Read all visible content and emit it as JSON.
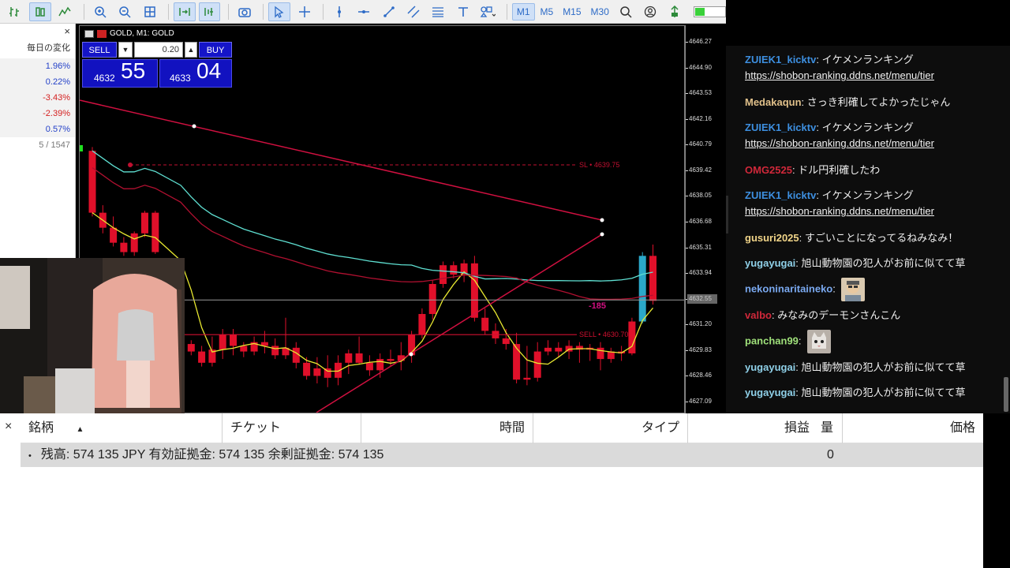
{
  "toolbar": {
    "timeframes": [
      "M1",
      "M5",
      "M15",
      "M30"
    ],
    "active_timeframe": "M1"
  },
  "market_watch": {
    "column_header": "毎日の変化",
    "rows": [
      {
        "value": "1.96%",
        "dir": "pos"
      },
      {
        "value": "0.22%",
        "dir": "pos"
      },
      {
        "value": "-3.43%",
        "dir": "neg"
      },
      {
        "value": "-2.39%",
        "dir": "neg"
      },
      {
        "value": "0.57%",
        "dir": "pos"
      }
    ],
    "count": "5 / 1547",
    "close": "×"
  },
  "chart": {
    "title": "GOLD, M1: GOLD",
    "sell_label": "SELL",
    "buy_label": "BUY",
    "lot": "0.20",
    "sell_price_small": "4632",
    "sell_price_big": "55",
    "buy_price_small": "4633",
    "buy_price_big": "04",
    "sl_label": "SL • 4639.75",
    "sell_order_label": "SELL • 4630.70",
    "pnl_label": "-185",
    "current_price": "4632.55",
    "colors": {
      "bear": "#e0102a",
      "bull": "#2ba8c9",
      "ma_yellow": "#e8e830",
      "ma_cyan": "#5fe0d2",
      "ma_red": "#b01030",
      "trend": "#d01040"
    }
  },
  "chart_data": {
    "type": "candlestick",
    "title": "GOLD, M1: GOLD",
    "y_ticks": [
      "4646.27",
      "4644.90",
      "4643.53",
      "4642.16",
      "4640.79",
      "4639.42",
      "4638.05",
      "4636.68",
      "4635.31",
      "4633.94",
      "4632.57",
      "4631.20",
      "4629.83",
      "4628.46",
      "4627.09"
    ],
    "ylim": [
      4627.09,
      4646.27
    ],
    "ohlc": [
      [
        4640.5,
        4640.7,
        4637.0,
        4637.2
      ],
      [
        4637.2,
        4637.6,
        4636.1,
        4636.4
      ],
      [
        4636.4,
        4637.0,
        4635.4,
        4635.6
      ],
      [
        4635.6,
        4635.9,
        4634.9,
        4635.1
      ],
      [
        4635.1,
        4636.2,
        4634.9,
        4636.1
      ],
      [
        4636.1,
        4637.3,
        4635.9,
        4637.2
      ],
      [
        4637.2,
        4637.3,
        4635.0,
        4635.1
      ],
      [
        4630.9,
        4631.3,
        4630.0,
        4630.2
      ],
      [
        4630.2,
        4630.4,
        4629.6,
        4629.8
      ],
      [
        4629.8,
        4630.1,
        4629.0,
        4629.2
      ],
      [
        4629.2,
        4630.6,
        4629.0,
        4629.9
      ],
      [
        4629.9,
        4631.0,
        4629.4,
        4630.7
      ],
      [
        4630.7,
        4631.0,
        4629.6,
        4630.1
      ],
      [
        4630.1,
        4630.3,
        4629.5,
        4629.8
      ],
      [
        4629.8,
        4630.6,
        4629.6,
        4630.3
      ],
      [
        4630.3,
        4630.9,
        4629.7,
        4630.1
      ],
      [
        4630.1,
        4630.5,
        4629.4,
        4629.6
      ],
      [
        4629.6,
        4631.6,
        4629.4,
        4630.0
      ],
      [
        4630.0,
        4630.3,
        4628.9,
        4629.2
      ],
      [
        4629.2,
        4629.5,
        4628.3,
        4628.5
      ],
      [
        4628.5,
        4629.5,
        4628.1,
        4628.9
      ],
      [
        4628.9,
        4629.6,
        4627.9,
        4628.4
      ],
      [
        4628.4,
        4629.6,
        4628.0,
        4629.2
      ],
      [
        4629.2,
        4629.9,
        4628.6,
        4629.7
      ],
      [
        4629.7,
        4630.6,
        4629.1,
        4629.2
      ],
      [
        4629.2,
        4629.6,
        4628.5,
        4628.8
      ],
      [
        4628.8,
        4629.7,
        4628.4,
        4629.4
      ],
      [
        4629.4,
        4629.9,
        4629.0,
        4629.3
      ],
      [
        4629.3,
        4630.3,
        4628.8,
        4629.6
      ],
      [
        4629.6,
        4630.9,
        4629.2,
        4630.7
      ],
      [
        4630.7,
        4632.1,
        4630.5,
        4631.8
      ],
      [
        4631.8,
        4633.6,
        4631.5,
        4633.4
      ],
      [
        4633.4,
        4634.6,
        4633.2,
        4634.4
      ],
      [
        4634.4,
        4634.6,
        4633.7,
        4633.9
      ],
      [
        4633.9,
        4634.7,
        4633.5,
        4634.5
      ],
      [
        4634.5,
        4634.9,
        4631.4,
        4631.6
      ],
      [
        4631.6,
        4632.1,
        4630.7,
        4630.9
      ],
      [
        4630.9,
        4631.3,
        4630.2,
        4630.5
      ],
      [
        4630.5,
        4631.0,
        4629.9,
        4630.2
      ],
      [
        4630.2,
        4630.8,
        4628.1,
        4628.3
      ],
      [
        4628.3,
        4630.1,
        4628.0,
        4628.4
      ],
      [
        4628.4,
        4630.3,
        4628.2,
        4629.8
      ],
      [
        4629.8,
        4630.4,
        4629.6,
        4630.0
      ],
      [
        4630.0,
        4630.3,
        4629.5,
        4629.8
      ],
      [
        4629.8,
        4630.4,
        4629.4,
        4630.1
      ],
      [
        4630.1,
        4630.3,
        4629.2,
        4629.9
      ],
      [
        4629.9,
        4630.2,
        4629.3,
        4630.0
      ],
      [
        4630.0,
        4630.3,
        4628.8,
        4629.4
      ],
      [
        4629.4,
        4630.0,
        4629.2,
        4629.8
      ],
      [
        4629.8,
        4630.1,
        4629.3,
        4629.7
      ],
      [
        4629.7,
        4631.6,
        4629.6,
        4631.4
      ],
      [
        4631.4,
        4635.1,
        4631.3,
        4634.9
      ],
      [
        4634.9,
        4635.5,
        4632.3,
        4632.5
      ]
    ]
  },
  "chat": {
    "messages": [
      {
        "user": "ZUIEK1_kicktv",
        "color": "#3d8fe0",
        "text": "イケメンランキング",
        "link": "https://shobon-ranking.ddns.net/menu/tier"
      },
      {
        "user": "Medakaqun",
        "color": "#e0c08a",
        "text": "さっき利確してよかったじゃん"
      },
      {
        "user": "ZUIEK1_kicktv",
        "color": "#3d8fe0",
        "text": "イケメンランキング",
        "link": "https://shobon-ranking.ddns.net/menu/tier"
      },
      {
        "user": "OMG2525",
        "color": "#d0283a",
        "text": "ドル円利確したわ"
      },
      {
        "user": "ZUIEK1_kicktv",
        "color": "#3d8fe0",
        "text": "イケメンランキング",
        "link": "https://shobon-ranking.ddns.net/menu/tier"
      },
      {
        "user": "gusuri2025",
        "color": "#f0d488",
        "text": "すごいことになってるねみなみ！"
      },
      {
        "user": "yugayugai",
        "color": "#8fd0e8",
        "text": "旭山動物園の犯人がお前に似てて草"
      },
      {
        "user": "nekoninaritaineko",
        "color": "#7aa9f0",
        "text": ""
      },
      {
        "user": "valbo",
        "color": "#d0283a",
        "text": "みなみのデーモンさんこん"
      },
      {
        "user": "panchan99",
        "color": "#9fe07a",
        "text": ""
      },
      {
        "user": "yugayugai",
        "color": "#8fd0e8",
        "text": "旭山動物園の犯人がお前に似てて草"
      },
      {
        "user": "yugayugai",
        "color": "#8fd0e8",
        "text": "旭山動物園の犯人がお前に似てて草"
      }
    ]
  },
  "terminal": {
    "close": "×",
    "columns": [
      "銘柄",
      "チケット",
      "時間",
      "タイプ",
      "損益",
      "量",
      "価格"
    ],
    "sort_arrow": "▲",
    "balance_text": "残高: 574 135 JPY  有効証拠金: 574 135  余剰証拠金: 574 135",
    "balance_bullet": "•",
    "pnl_total": "0"
  }
}
